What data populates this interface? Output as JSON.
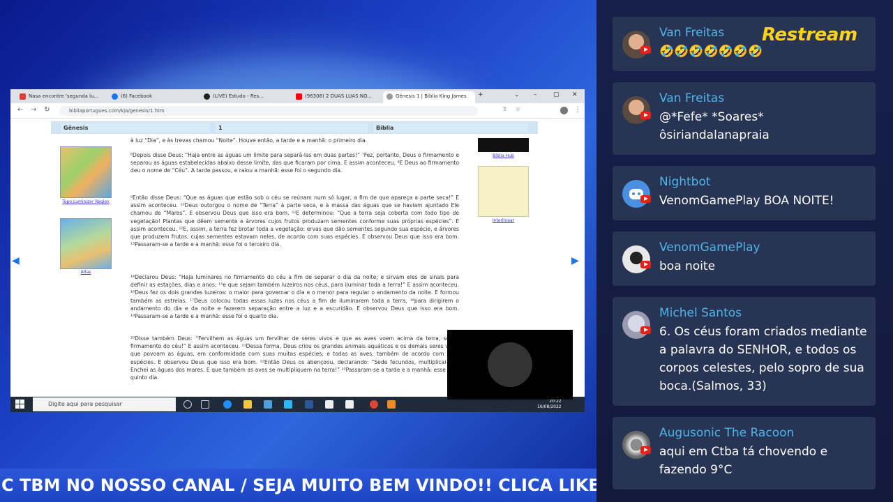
{
  "chat": {
    "logo_brand": "Restream",
    "messages": [
      {
        "name": "Van Freitas",
        "text": "🤣🤣🤣🤣🤣🤣🤣"
      },
      {
        "name": "Van Freitas",
        "text": "@*Fefe* *Soares* ôsiriandalanapraia"
      },
      {
        "name": "Nightbot",
        "text": "VenomGamePlay BOA NOITE!"
      },
      {
        "name": "VenomGamePlay",
        "text": "boa noite"
      },
      {
        "name": "Michel Santos",
        "text": "6. Os céus foram criados mediante a palavra do SENHOR, e todos os corpos celestes, pelo sopro de sua boca.(Salmos, 33)"
      },
      {
        "name": "Augusonic The Racoon",
        "text": "aqui em Ctba tá chovendo e fazendo 9°C"
      }
    ]
  },
  "ticker": {
    "text": "C TBM NO NOSSO CANAL / SEJA MUITO BEM VINDO!! CLICA LIKE"
  },
  "browser": {
    "tabs": [
      "Nasa encontre 'segunda lu...",
      "(6) Facebook",
      "(LIVE) Estudo - Res...",
      "(96308) 2 DUAS LUAS NO...",
      "Gênesis 1 | Bíblia King James"
    ],
    "url": "bibliaportugues.com/kja/genesis/1.htm",
    "selectors": {
      "book": "Gênesis",
      "chapter": "1",
      "version": "Bíblia"
    },
    "map_captions": [
      "Topo Luminizer Region",
      "Atlas"
    ],
    "side_links": [
      "Bíblia Hub",
      "Interlinear"
    ],
    "paragraphs": [
      "à luz “Dia”, e às trevas chamou “Noite”. Houve então, a tarde e a manhã: o primeiro dia.",
      "⁶Depois disse Deus: “Haja entre as águas um limite para separá-las em duas partes!” ⁷Fez, portanto, Deus o firmamento e separou as águas estabelecidas abaixo desse limite, das que ficaram por cima. E assim aconteceu. ⁸E Deus ao firmamento deu o nome de “Céu”. A tarde passou, e raiou a manhã: esse foi o segundo dia.",
      "⁹Então disse Deus: “Que as águas que estão sob o céu se reúnam num só lugar, a fim de que apareça a parte seca!” E assim aconteceu. ¹⁰Deus outorgou o nome de “Terra” à parte seca, e à massa das águas que se haviam ajuntado Ele chamou de “Mares”. E observou Deus que isso era bom. ¹¹E determinou: “Que a terra seja coberta com todo tipo de vegetação! Plantas que dêem semente e árvores cujos frutos produzam sementes conforme suas próprias espécies”. E assim aconteceu. ¹²E, assim, a terra fez brotar toda a vegetação: ervas que dão sementes segundo sua espécie, e árvores que produzem frutos, cujas sementes estavam neles, de acordo com suas espécies. E observou Deus que isso era bom. ¹³Passaram-se a tarde e a manhã: esse foi o terceiro dia.",
      "¹⁴Declarou Deus: “Haja luminares no firmamento do céu a fim de separar o dia da noite; e sirvam eles de sinais para definir as estações, dias e anos; ¹⁵e que sejam também luzeiros nos céus, para iluminar toda a terra!” E assim aconteceu. ¹⁶Deus fez os dois grandes luzeiros: o maior para governar o dia e o menor para regular o andamento da noite. E formou também as estrelas. ¹⁷Deus colocou todas essas luzes nos céus a fim de iluminarem toda a terra, ¹⁸para dirigirem o andamento do dia e da noite e fazerem separação entre a luz e a escuridão. E observou Deus que isso era bom. ¹⁹Passaram-se a tarde e a manhã: esse foi o quarto dia.",
      "²⁰Disse também Deus: “Fervilhem as águas um fervilhar de seres vivos e que as aves voem acima da terra, sob o firmamento do céu!” E assim aconteceu. ²¹Dessa forma, Deus criou os grandes animais aquáticos e os demais seres vivos que povoam as águas, em conformidade com suas muitas espécies; e todas as aves, também de acordo com suas espécies. E observou Deus que isso era bom. ²²Então Deus os abençoou, declarando: “Sede fecundos, multiplicai-vos! Enchei as águas dos mares. E que também as aves se multipliquem na terra!” ²³Passaram-se a tarde e a manhã: esse foi o quinto dia."
    ],
    "taskbar_search": "Digite aqui para pesquisar",
    "clock": {
      "time": "20:22",
      "date": "16/08/2022"
    }
  },
  "colors": {
    "chat_name": "#4fb4e8",
    "chat_card": "#283454",
    "ticker_bg": "#2c58d8",
    "youtube": "#e62117"
  }
}
